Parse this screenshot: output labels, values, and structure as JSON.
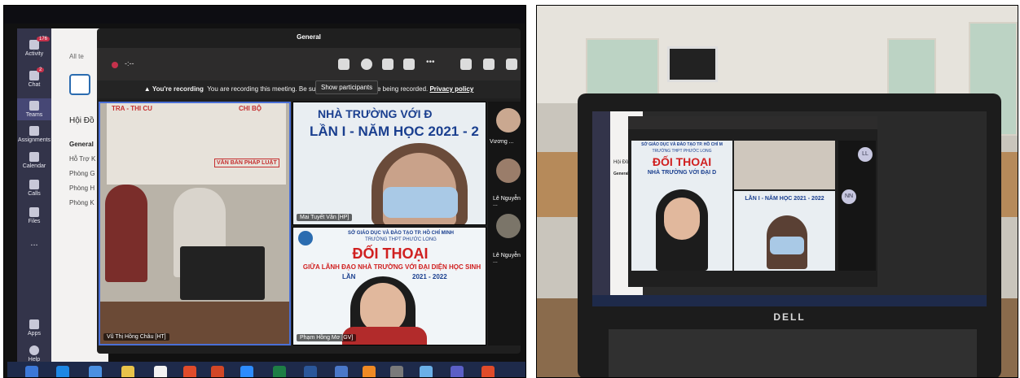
{
  "left_photo": {
    "rail": {
      "items": [
        {
          "label": "Activity",
          "badge": "176"
        },
        {
          "label": "Chat",
          "badge": "2"
        },
        {
          "label": "Teams",
          "badge": ""
        },
        {
          "label": "Assignments",
          "badge": ""
        },
        {
          "label": "Calendar",
          "badge": ""
        },
        {
          "label": "Calls",
          "badge": ""
        },
        {
          "label": "Files",
          "badge": ""
        },
        {
          "label": "...",
          "badge": ""
        },
        {
          "label": "Apps",
          "badge": ""
        },
        {
          "label": "Help",
          "badge": ""
        }
      ]
    },
    "teams_list": {
      "back_label": "All te",
      "team_name": "Hội Đồ",
      "channels": [
        "General",
        "Hỗ Trợ K",
        "Phòng G",
        "Phòng H",
        "Phòng K"
      ]
    },
    "meeting": {
      "title": "General",
      "timer": "-:--",
      "tooltip": "Show participants",
      "recording_banner": {
        "bold": "You're recording",
        "text": "You are recording this meeting. Be sure to let",
        "text2": "hey are being recorded.",
        "link": "Privacy policy"
      },
      "tiles": [
        {
          "name": "Vũ Thị Hồng Châu [HT]"
        },
        {
          "name": "Mai Tuyết Vân [HP]"
        },
        {
          "name": "Phạm Hồng Mơ [GV]"
        }
      ],
      "banner_text": {
        "line1": "NHÀ TRƯỜNG VỚI Đ",
        "line2": "LẦN I - NĂM HỌC 2021 - 2",
        "sign1": "TRA - THI CU",
        "sign2": "CHI BỘ",
        "sign3": "VĂN BẢN PHÁP LUẬT"
      },
      "slide": {
        "line1": "SỞ GIÁO DỤC VÀ ĐÀO TẠO TP. HỒ CHÍ MINH",
        "line2": "TRƯỜNG THPT PHƯỚC LONG",
        "title": "ĐỐI THOẠI",
        "sub": "GIỮA LÃNH ĐẠO NHÀ TRƯỜNG VỚI ĐẠI DIỆN HỌC SINH",
        "sub2": "LẦN",
        "year": "2021 - 2022"
      },
      "side_participants": [
        {
          "name": "Vương ..."
        },
        {
          "name": "Lê Nguyễn ..."
        },
        {
          "name": "Lê Nguyễn ..."
        }
      ]
    }
  },
  "right_photo": {
    "brand": "DELL",
    "screen": {
      "slide_title": "ĐỐI THOẠI",
      "slide_sub": "NHÀ TRƯỜNG VỚI ĐẠI D",
      "slide_year": "LẦN I - NĂM HỌC 2021 - 2022",
      "slide_line1": "SỞ GIÁO DỤC VÀ ĐÀO TẠO TP. HỒ CHÍ M",
      "slide_line2": "TRƯỜNG THPT PHƯỚC LONG",
      "participant_initials": [
        "LL",
        "NN"
      ],
      "team_name": "Hội Đồ",
      "channel": "General"
    }
  },
  "colors": {
    "teams_rail": "#33344a",
    "recording_red": "#c4314b",
    "slide_red": "#d02020",
    "slide_blue": "#1a3f8f"
  }
}
